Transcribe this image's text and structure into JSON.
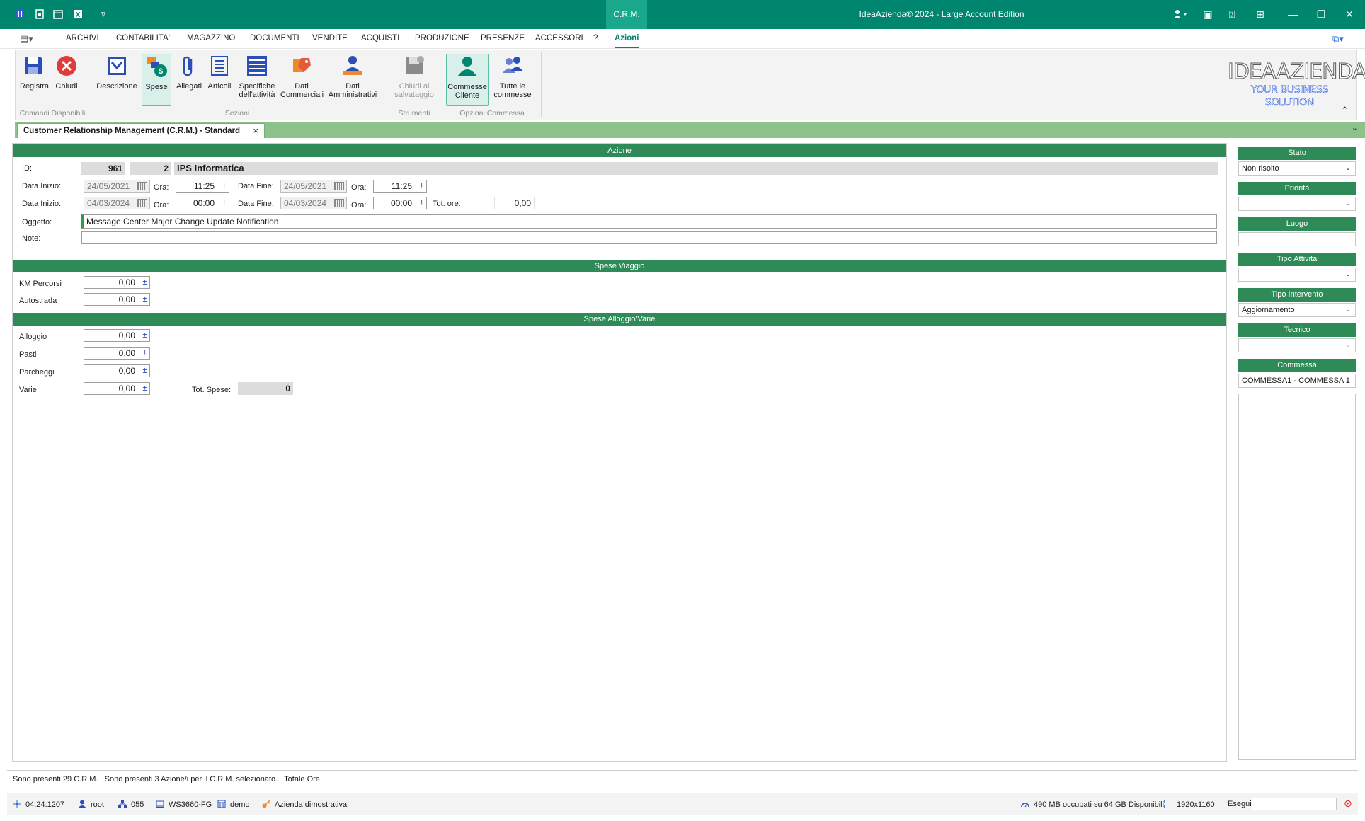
{
  "titlebar": {
    "app_title": "IdeaAzienda® 2024 - Large Account Edition",
    "active_module": "C.R.M."
  },
  "menu": {
    "items": [
      "ARCHIVI",
      "CONTABILITA'",
      "MAGAZZINO",
      "DOCUMENTI",
      "VENDITE",
      "ACQUISTI",
      "PRODUZIONE",
      "PRESENZE",
      "ACCESSORI",
      "?",
      "Azioni"
    ]
  },
  "ribbon": {
    "buttons": {
      "registra": "Registra",
      "chiudi": "Chiudi",
      "descrizione": "Descrizione",
      "spese": "Spese",
      "allegati": "Allegati",
      "articoli": "Articoli",
      "specifiche_1": "Specifiche",
      "specifiche_2": "dell'attività",
      "dati_comm_1": "Dati",
      "dati_comm_2": "Commerciali",
      "dati_amm_1": "Dati",
      "dati_amm_2": "Amministrativi",
      "chiudi_salv_1": "Chiudi al",
      "chiudi_salv_2": "salvataggio",
      "commesse_cliente_1": "Commesse",
      "commesse_cliente_2": "Cliente",
      "tutte_commesse_1": "Tutte le",
      "tutte_commesse_2": "commesse"
    },
    "groups": {
      "comandi": "Comandi Disponibili",
      "sezioni": "Sezioni",
      "strumenti": "Strumenti",
      "opzioni": "Opzioni Commessa"
    },
    "logo_line1": "IDEAAZIENDA",
    "logo_line2": "YOUR BUSINESS SOLUTION"
  },
  "doc_tab": {
    "title": "Customer Relationship Management (C.R.M.) - Standard"
  },
  "azione": {
    "header": "Azione",
    "id_label": "ID:",
    "id_value": "961",
    "seq_value": "2",
    "company": "IPS Informatica",
    "data_inizio_label": "Data Inizio:",
    "data_fine_label": "Data Fine:",
    "ora_label": "Ora:",
    "row1": {
      "data_inizio": "24/05/2021",
      "ora_inizio": "11:25",
      "data_fine": "24/05/2021",
      "ora_fine": "11:25"
    },
    "row2": {
      "data_inizio": "04/03/2024",
      "ora_inizio": "00:00",
      "data_fine": "04/03/2024",
      "ora_fine": "00:00"
    },
    "tot_ore_label": "Tot. ore:",
    "tot_ore": "0,00",
    "oggetto_label": "Oggetto:",
    "oggetto": "Message Center Major Change Update Notification",
    "note_label": "Note:",
    "note": ""
  },
  "spese_viaggio": {
    "header": "Spese Viaggio",
    "km_label": "KM Percorsi",
    "km": "0,00",
    "autostrada_label": "Autostrada",
    "autostrada": "0,00"
  },
  "spese_alloggio": {
    "header": "Spese Alloggio/Varie",
    "alloggio_label": "Alloggio",
    "alloggio": "0,00",
    "pasti_label": "Pasti",
    "pasti": "0,00",
    "parcheggi_label": "Parcheggi",
    "parcheggi": "0,00",
    "varie_label": "Varie",
    "varie": "0,00",
    "tot_spese_label": "Tot. Spese:",
    "tot_spese": "0"
  },
  "right_panel": {
    "stato_label": "Stato",
    "stato": "Non risolto",
    "priorita_label": "Priorità",
    "priorita": "",
    "luogo_label": "Luogo",
    "luogo": "",
    "tipo_attivita_label": "Tipo Attività",
    "tipo_attivita": "",
    "tipo_intervento_label": "Tipo Intervento",
    "tipo_intervento": "Aggiornamento",
    "tecnico_label": "Tecnico",
    "tecnico": "",
    "commessa_label": "Commessa",
    "commessa": "COMMESSA1 - COMMESSA 1"
  },
  "status": {
    "line": "Sono presenti 29 C.R.M.   Sono presenti 3 Azione/i per il C.R.M. selezionato.   Totale Ore",
    "version": "04.24.1207",
    "user": "root",
    "code": "055",
    "workstation": "WS3660-FG",
    "db": "demo",
    "company": "Azienda dimostrativa",
    "memory": "490 MB occupati su 64 GB Disponibili",
    "resolution": "1920x1160",
    "esegui_label": "Esegui"
  },
  "colors": {
    "title_green": "#00856f",
    "section_green": "#2e8b57",
    "tab_green": "#8ec28c"
  }
}
